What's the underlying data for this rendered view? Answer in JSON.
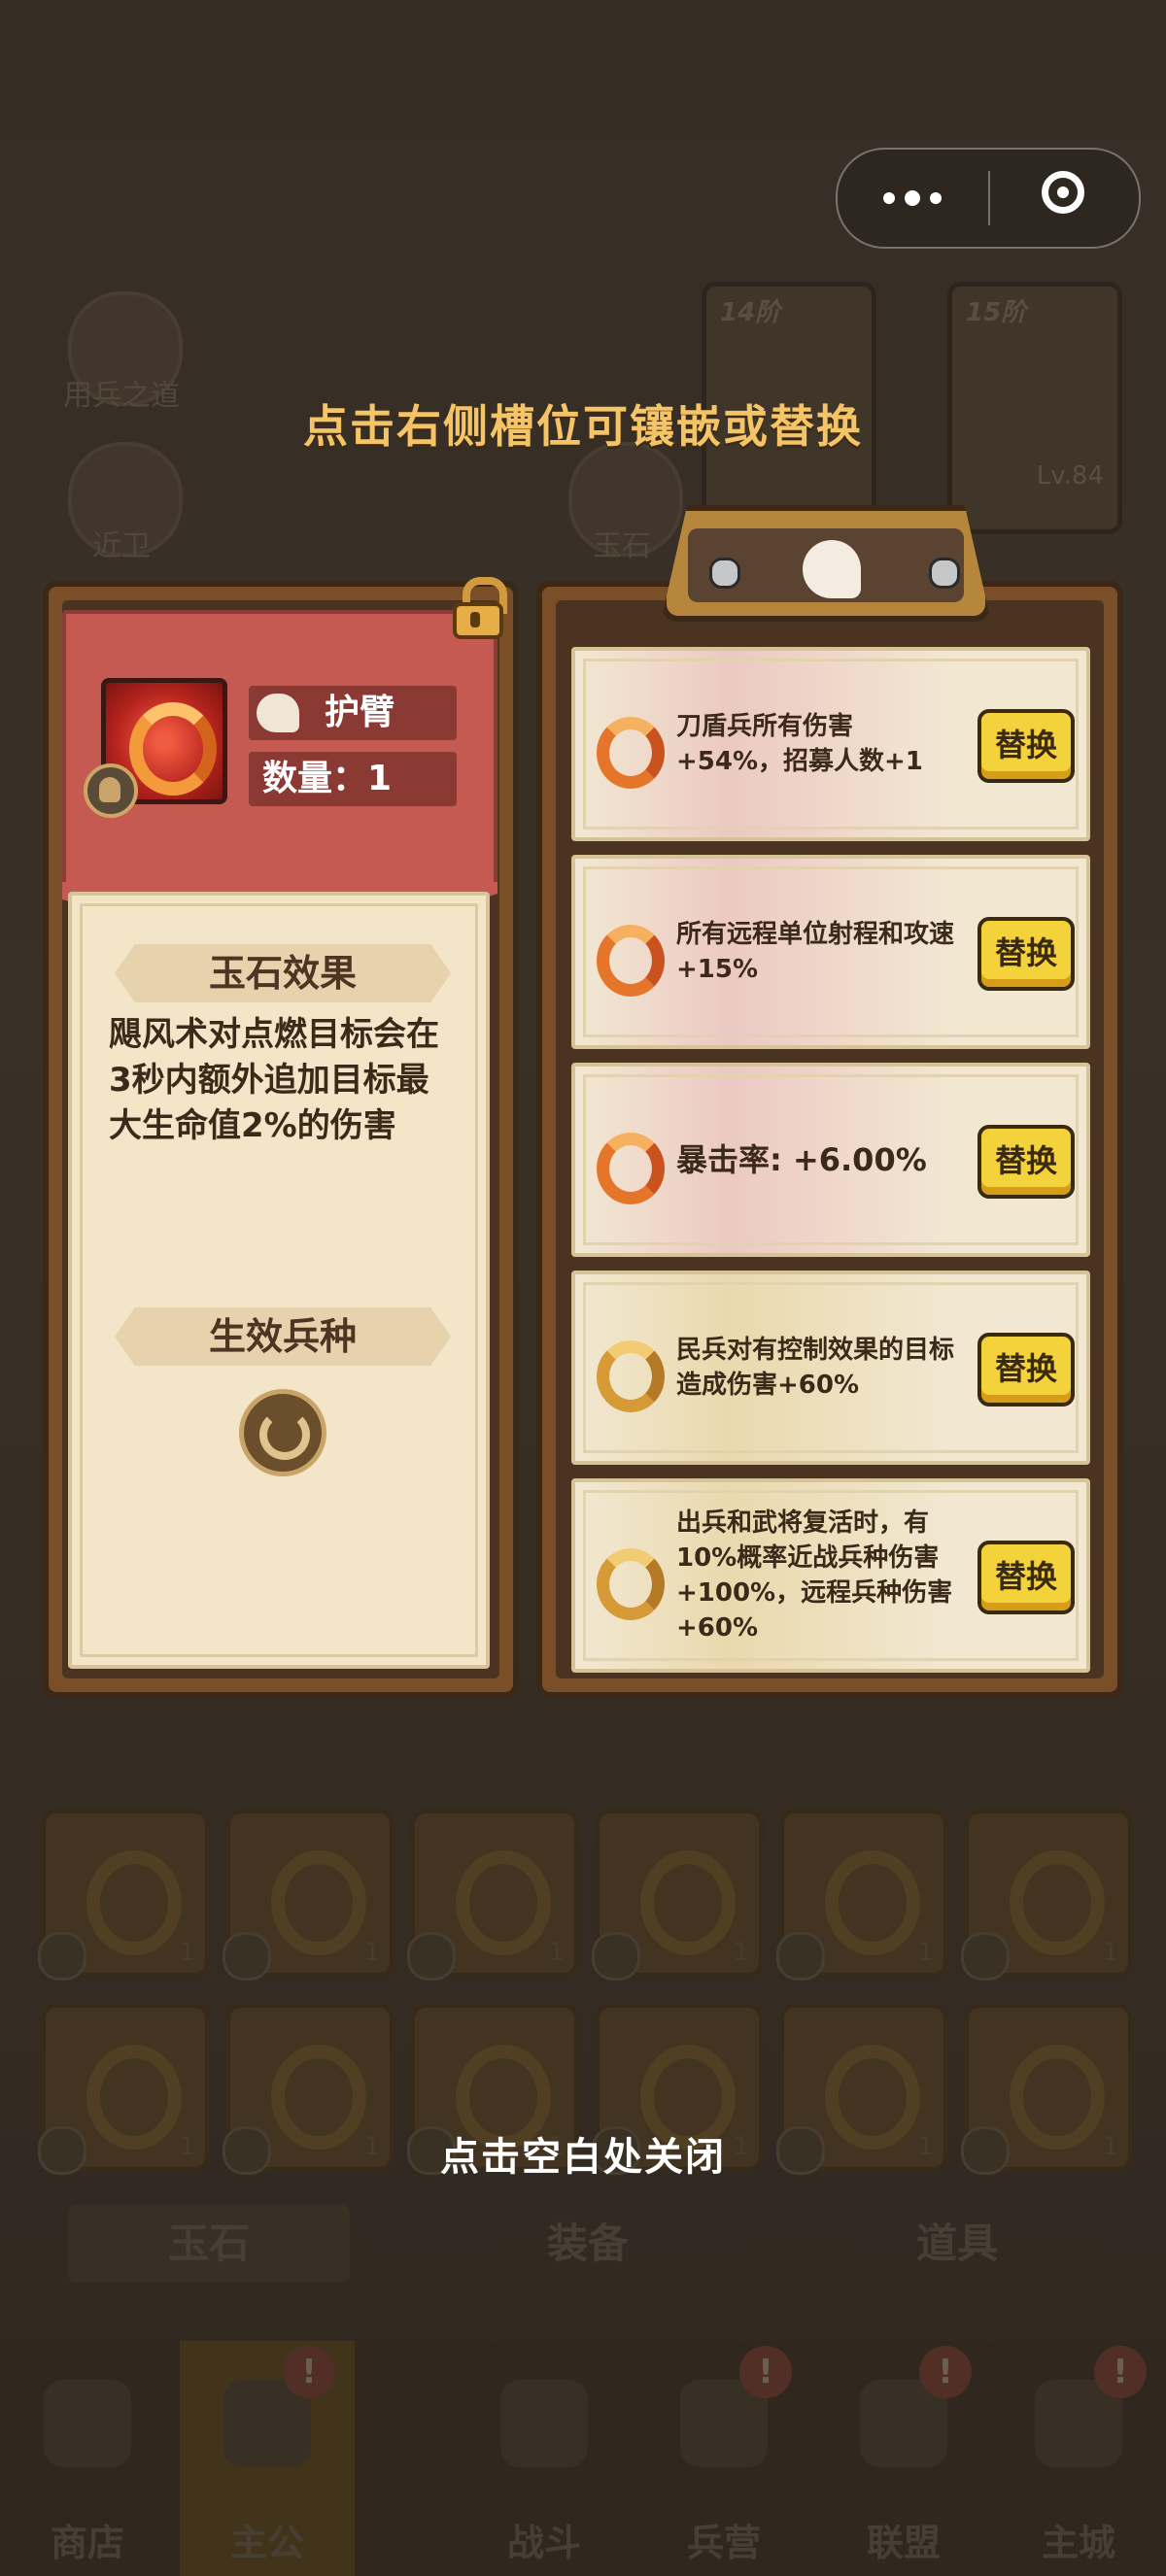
{
  "background": {
    "topics": [
      {
        "label": "用兵之道"
      },
      {
        "label": "近卫"
      },
      {
        "label": "玉石"
      }
    ],
    "cards": [
      {
        "tier": "14阶",
        "level": ""
      },
      {
        "tier": "15阶",
        "level": "Lv.84"
      }
    ],
    "slot_count": "1",
    "tabs": [
      "玉石",
      "装备",
      "道具"
    ],
    "nav": [
      {
        "label": "商店",
        "icon": "shop-icon"
      },
      {
        "label": "主公",
        "icon": "lord-icon"
      },
      {
        "label": "战斗",
        "icon": "battle-icon"
      },
      {
        "label": "兵营",
        "icon": "barracks-icon"
      },
      {
        "label": "联盟",
        "icon": "alliance-icon"
      },
      {
        "label": "主城",
        "icon": "city-icon"
      }
    ],
    "alert_mark": "!"
  },
  "hint_top": "点击右侧槽位可镶嵌或替换",
  "hint_bottom": "点击空白处关闭",
  "gem": {
    "slot_name": "护臂",
    "quantity": "数量：1",
    "effect_title": "玉石效果",
    "effect_text": "飓风术对点燃目标会在3秒内额外追加目标最大生命值2%的伤害",
    "troop_title": "生效兵种"
  },
  "effects": [
    {
      "text": "刀盾兵所有伤害+54%，招募人数+1",
      "button": "替换",
      "tone": "red"
    },
    {
      "text": "所有远程单位射程和攻速+15%",
      "button": "替换",
      "tone": "red"
    },
    {
      "text": "暴击率: +6.00%",
      "button": "替换",
      "tone": "red"
    },
    {
      "text": "民兵对有控制效果的目标造成伤害+60%",
      "button": "替换",
      "tone": "gold"
    },
    {
      "text": "出兵和武将复活时，有10%概率近战兵种伤害+100%，远程兵种伤害+60%",
      "button": "替换",
      "tone": "gold"
    }
  ],
  "colors": {
    "hint": "#f4c466",
    "banner_red": "#c55a52",
    "button_yellow": "#f4d23c",
    "panel_brown": "#7a4f27"
  }
}
